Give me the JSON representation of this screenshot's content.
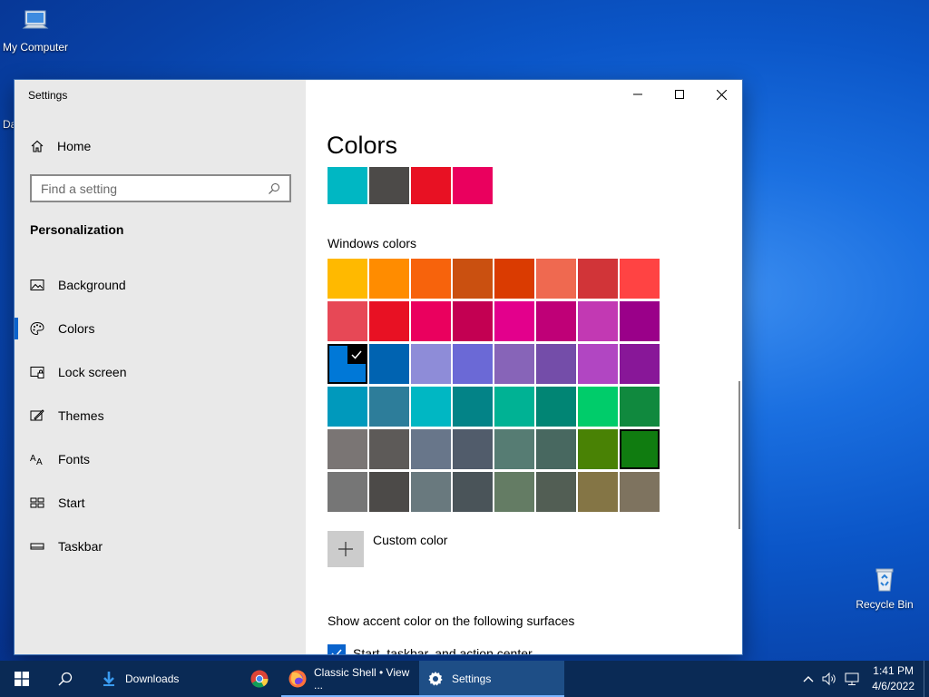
{
  "desktop": {
    "icons": [
      {
        "label": "My Computer"
      },
      {
        "label": "Recycle Bin"
      }
    ],
    "partial_labels": [
      "Da"
    ]
  },
  "window": {
    "title": "Settings",
    "sidebar": {
      "home_label": "Home",
      "search_placeholder": "Find a setting",
      "section_title": "Personalization",
      "items": [
        {
          "label": "Background",
          "icon": "picture-icon",
          "active": false
        },
        {
          "label": "Colors",
          "icon": "palette-icon",
          "active": true
        },
        {
          "label": "Lock screen",
          "icon": "lock-screen-icon",
          "active": false
        },
        {
          "label": "Themes",
          "icon": "themes-icon",
          "active": false
        },
        {
          "label": "Fonts",
          "icon": "fonts-icon",
          "active": false
        },
        {
          "label": "Start",
          "icon": "start-icon",
          "active": false
        },
        {
          "label": "Taskbar",
          "icon": "taskbar-icon",
          "active": false
        }
      ]
    },
    "content": {
      "title": "Colors",
      "recent_colors": [
        "#00b7c3",
        "#4c4a48",
        "#e81123",
        "#ea005e"
      ],
      "windows_colors_label": "Windows colors",
      "windows_colors": [
        "#ffb900",
        "#ff8c00",
        "#f7630c",
        "#ca5010",
        "#da3b01",
        "#ef6950",
        "#d13438",
        "#ff4343",
        "#e74856",
        "#e81123",
        "#ea005e",
        "#c30052",
        "#e3008c",
        "#bf0077",
        "#c239b3",
        "#9a0089",
        "#0078d7",
        "#0063b1",
        "#8e8cd8",
        "#6b69d6",
        "#8764b8",
        "#744da9",
        "#b146c2",
        "#881798",
        "#0099bc",
        "#2d7d9a",
        "#00b7c3",
        "#038387",
        "#00b294",
        "#018574",
        "#00cc6a",
        "#10893e",
        "#7a7574",
        "#5d5a58",
        "#68768a",
        "#515c6b",
        "#567c73",
        "#486860",
        "#498205",
        "#107c10",
        "#767676",
        "#4c4a48",
        "#69797e",
        "#4a5459",
        "#647c64",
        "#525e54",
        "#847545",
        "#7e735f"
      ],
      "selected_index": 16,
      "hover_index": 39,
      "custom_color_label": "Custom color",
      "surfaces_label": "Show accent color on the following surfaces",
      "start_checkbox_label": "Start, taskbar, and action center",
      "start_checkbox_checked": true,
      "accent_color": "#0a63cc"
    }
  },
  "taskbar": {
    "apps": [
      {
        "label": "Downloads",
        "icon": "download-folder-icon",
        "running": false,
        "active": false
      },
      {
        "label": "",
        "icon": "chrome-icon",
        "running": false,
        "active": false
      },
      {
        "label": "Classic Shell • View ...",
        "icon": "firefox-icon",
        "running": true,
        "active": false
      },
      {
        "label": "Settings",
        "icon": "gear-icon",
        "running": true,
        "active": true
      }
    ],
    "time": "1:41 PM",
    "date": "4/6/2022"
  }
}
